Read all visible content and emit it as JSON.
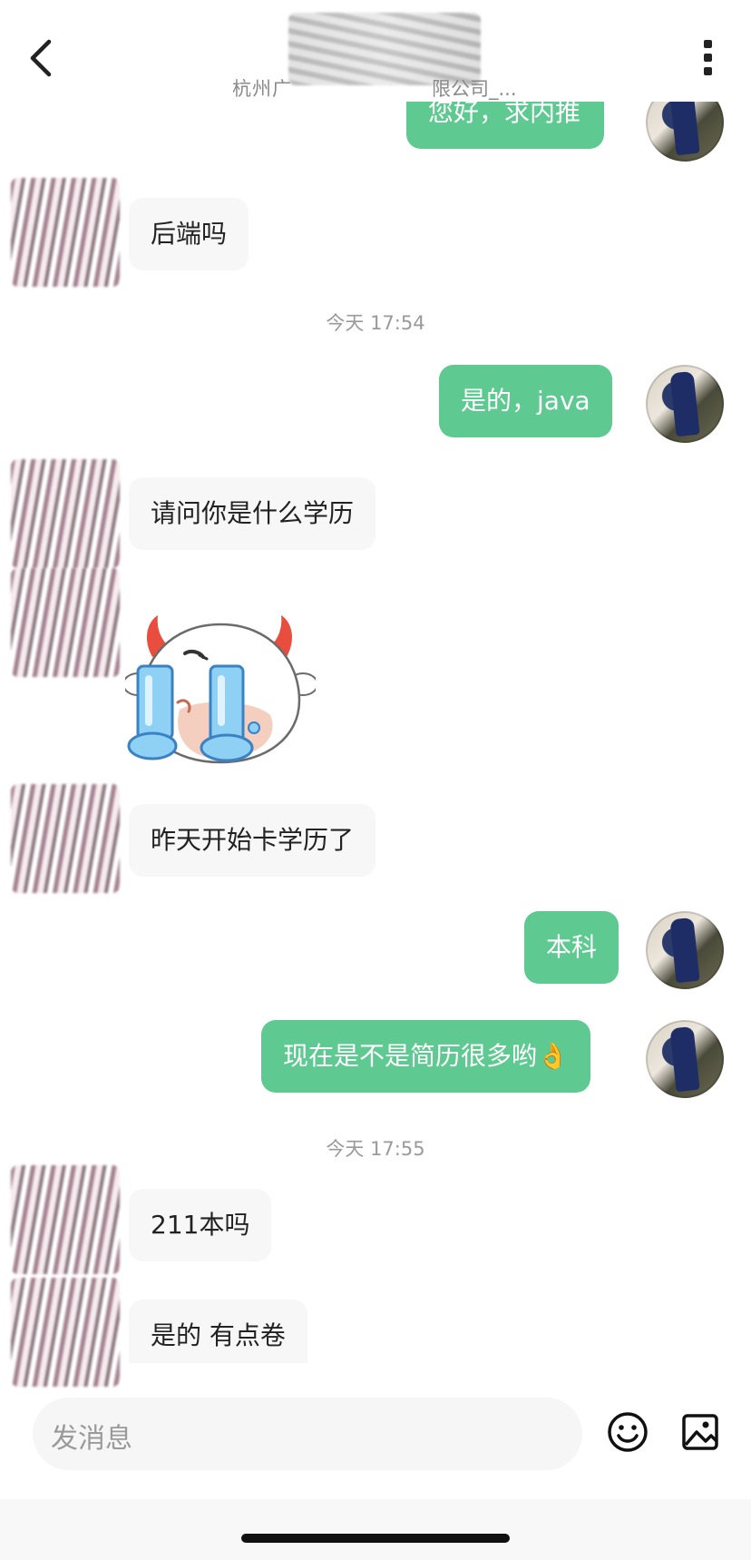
{
  "header": {
    "subtitle_left": "杭州广",
    "subtitle_right": "限公司_..."
  },
  "messages": [
    {
      "side": "out",
      "text": "您好，求内推"
    },
    {
      "side": "in",
      "text": "后端吗"
    },
    {
      "type": "timestamp",
      "text": "今天 17:54"
    },
    {
      "side": "out",
      "text": "是的，java"
    },
    {
      "side": "in",
      "text": "请问你是什么学历"
    },
    {
      "side": "in",
      "type": "sticker",
      "sticker": "crying-cow-sticker"
    },
    {
      "side": "in",
      "text": "昨天开始卡学历了"
    },
    {
      "side": "out",
      "text": "本科"
    },
    {
      "side": "out",
      "text": "现在是不是简历很多哟👌"
    },
    {
      "type": "timestamp",
      "text": "今天 17:55"
    },
    {
      "side": "in",
      "text": "211本吗"
    },
    {
      "side": "in",
      "text": "是的 有点卷"
    }
  ],
  "input": {
    "placeholder": "发消息"
  },
  "icons": {
    "back": "chevron-left-icon",
    "more": "more-vertical-icon",
    "emoji": "smile-icon",
    "image": "image-icon"
  },
  "colors": {
    "outgoing_bubble": "#5ec990",
    "incoming_bubble": "#f7f7f7",
    "timestamp_text": "#9a9a9a"
  }
}
